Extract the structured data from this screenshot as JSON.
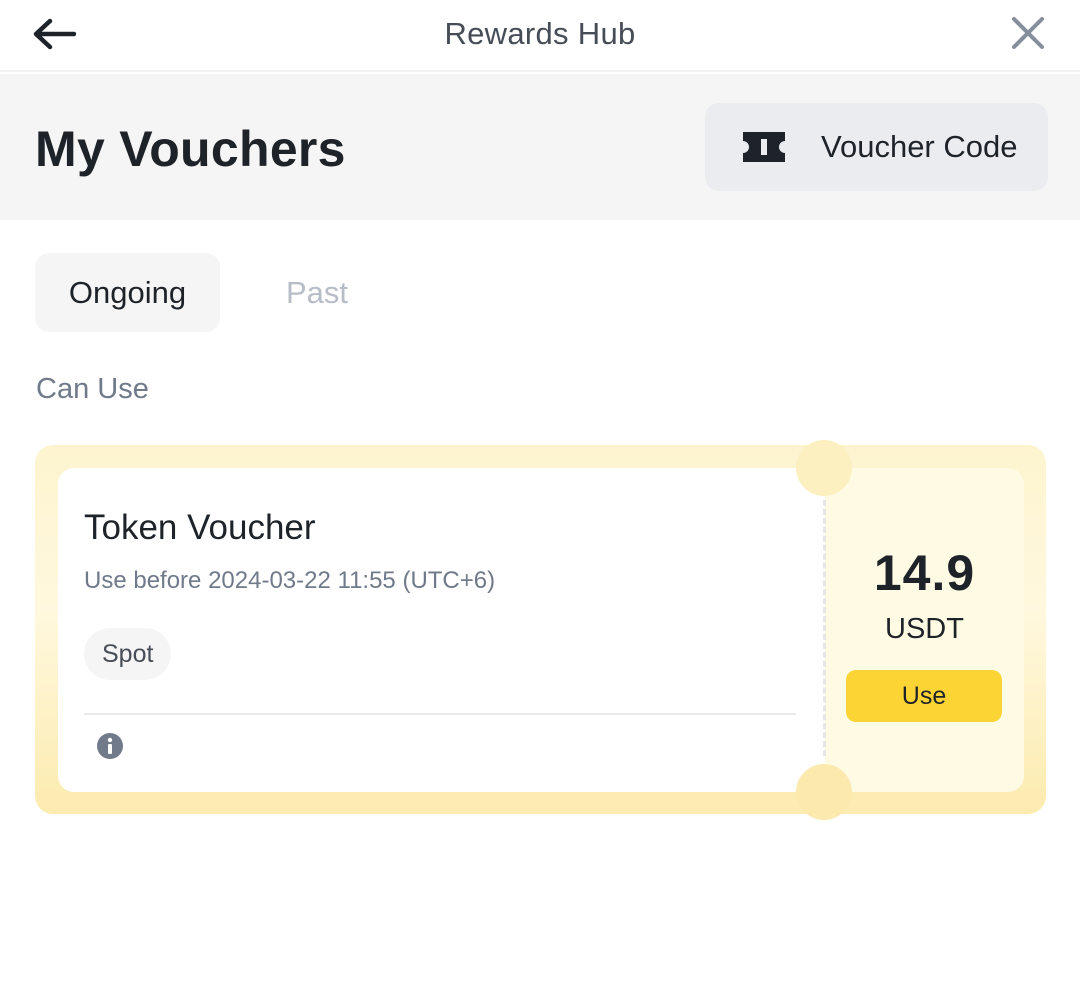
{
  "topbar": {
    "title": "Rewards Hub",
    "back_icon": "arrow-left-icon",
    "close_icon": "close-icon"
  },
  "header": {
    "title": "My Vouchers",
    "voucher_code_button": {
      "label": "Voucher Code",
      "icon": "ticket-icon"
    }
  },
  "tabs": [
    {
      "label": "Ongoing",
      "active": true
    },
    {
      "label": "Past",
      "active": false
    }
  ],
  "section_label": "Can Use",
  "vouchers": [
    {
      "title": "Token Voucher",
      "expiry": "Use before 2024-03-22 11:55 (UTC+6)",
      "tag": "Spot",
      "amount": "14.9",
      "currency": "USDT",
      "action_label": "Use",
      "info_icon": "info-icon"
    }
  ],
  "colors": {
    "accent": "#fcd535",
    "text_primary": "#1e2329",
    "text_secondary": "#707a8a",
    "tab_inactive": "#b7bdc6"
  }
}
